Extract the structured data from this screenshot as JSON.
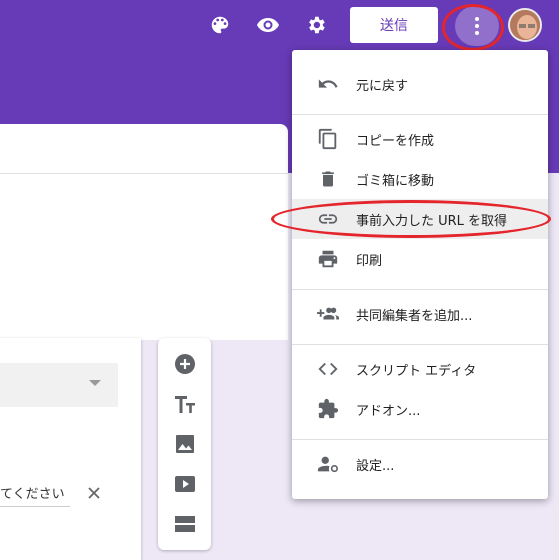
{
  "header": {
    "send_label": "送信",
    "icons": [
      "palette-icon",
      "eye-icon",
      "gear-icon",
      "more-vert-icon"
    ],
    "accent_color": "#673ab7"
  },
  "menu": {
    "items": [
      {
        "label": "元に戻す",
        "icon": "undo-icon"
      },
      {
        "label": "コピーを作成",
        "icon": "copy-icon"
      },
      {
        "label": "ゴミ箱に移動",
        "icon": "trash-icon"
      },
      {
        "label": "事前入力した URL を取得",
        "icon": "link-icon"
      },
      {
        "label": "印刷",
        "icon": "print-icon"
      },
      {
        "label": "共同編集者を追加...",
        "icon": "add-person-icon"
      },
      {
        "label": "スクリプト エディタ",
        "icon": "code-icon"
      },
      {
        "label": "アドオン...",
        "icon": "puzzle-icon"
      },
      {
        "label": "設定...",
        "icon": "settings-person-icon"
      }
    ]
  },
  "question": {
    "text": "てください"
  },
  "annotation_color": "#e4252c"
}
